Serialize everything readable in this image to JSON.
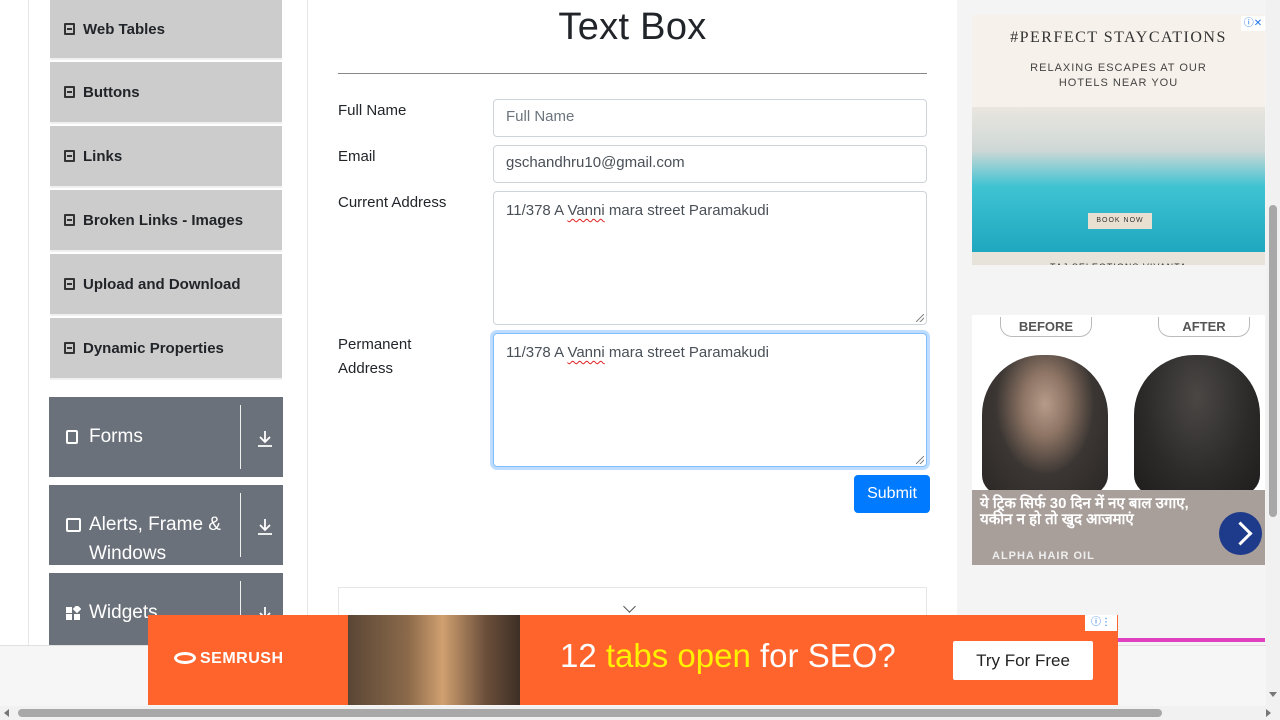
{
  "sidebar": {
    "sub_items": [
      {
        "label": "Web Tables"
      },
      {
        "label": "Buttons"
      },
      {
        "label": "Links"
      },
      {
        "label": "Broken Links - Images"
      },
      {
        "label": "Upload and Download"
      },
      {
        "label": "Dynamic Properties"
      }
    ],
    "groups": [
      {
        "label": "Forms"
      },
      {
        "label_line1": "Alerts, Frame &",
        "label_line2": "Windows"
      },
      {
        "label": "Widgets"
      }
    ]
  },
  "main": {
    "title": "Text Box",
    "full_name": {
      "label": "Full Name",
      "placeholder": "Full Name",
      "value": ""
    },
    "email": {
      "label": "Email",
      "value": "gschandhru10@gmail.com"
    },
    "current_address": {
      "label": "Current Address",
      "value_pre": "11/378 A ",
      "value_flagged": "Vanni",
      "value_post": " mara street Paramakudi"
    },
    "permanent_address": {
      "label_line1": "Permanent",
      "label_line2": "Address",
      "value_pre": "11/378 A ",
      "value_flagged": "Vanni",
      "value_post": " mara street Paramakudi"
    },
    "submit_label": "Submit"
  },
  "ads": {
    "hotel": {
      "hashtag": "#PERFECT STAYCATIONS",
      "line1": "RELAXING ESCAPES AT OUR",
      "line2": "HOTELS NEAR YOU",
      "cta": "BOOK NOW",
      "brands": "TAJ   SELEQTIONS   VIVANTA"
    },
    "hair": {
      "before": "BEFORE",
      "after": "AFTER",
      "caption": "ये ट्रिक सिर्फ 30 दिन में नए बाल उगाए, यकीन न हो तो खुद आजमाएं",
      "brand": "ALPHA HAIR OIL"
    },
    "banner": {
      "logo": "SEMRUSH",
      "headline_pre": "12 ",
      "headline_highlight": "tabs open",
      "headline_post": " for SEO?",
      "cta": "Try For Free"
    },
    "info_glyph": "ⓘ✕",
    "info_glyph2": "ⓘ⋮"
  },
  "colors": {
    "primary": "#007bff",
    "sidebar_item_bg": "#cccccc",
    "group_bg": "#6b717a",
    "banner_bg": "#ff642d",
    "headline_highlight": "#fff200"
  }
}
